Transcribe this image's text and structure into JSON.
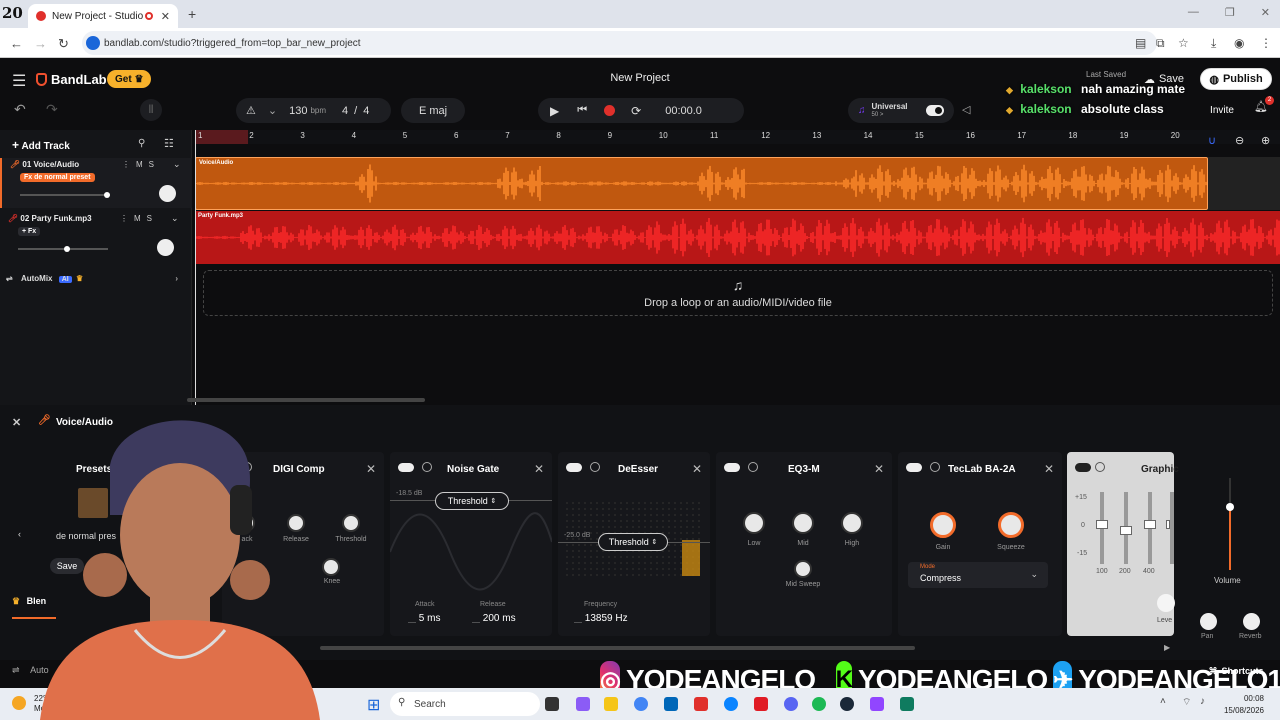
{
  "browser": {
    "counter": "20",
    "tab_title": "New Project - Studio",
    "url": "bandlab.com/studio?triggered_from=top_bar_new_project"
  },
  "app": {
    "brand": "BandLab",
    "get_label": "Get",
    "project_title": "New Project",
    "last_saved": "Last Saved",
    "save_label": "Save",
    "publish_label": "Publish",
    "invite_label": "Invite",
    "notification_count": "2"
  },
  "toolbar": {
    "tempo": "130",
    "tempo_unit": "bpm",
    "time_sig_num": "4",
    "time_sig_sep": "/",
    "time_sig_den": "4",
    "key": "E maj",
    "time": "00:00.0",
    "universal_label": "Universal",
    "universal_sub": "50 >"
  },
  "tracks": [
    {
      "label": "01  Voice/Audio",
      "fx": "Fx de normal preset",
      "clip": "Voice/Audio",
      "color": "#c0580f"
    },
    {
      "label": "02  Party Funk.mp3",
      "fx": "+ Fx",
      "clip": "Party Funk.mp3",
      "color": "#b81717"
    }
  ],
  "track_controls": {
    "mute": "M",
    "solo": "S"
  },
  "sidebar": {
    "add_track": "Add Track",
    "automix": "AutoMix",
    "ai_badge": "AI"
  },
  "ruler": [
    "1",
    "2",
    "3",
    "4",
    "5",
    "6",
    "7",
    "8",
    "9",
    "10",
    "11",
    "12",
    "13",
    "14",
    "15",
    "16",
    "17",
    "18",
    "19",
    "20"
  ],
  "dropzone": "Drop a loop or an audio/MIDI/video file",
  "chat": [
    {
      "user": "kalekson",
      "message": "nah amazing mate"
    },
    {
      "user": "kalekson",
      "message": "absolute class"
    }
  ],
  "fx_panel": {
    "track_name": "Voice/Audio",
    "presets_label": "Presets",
    "preset_name": "de normal pres",
    "save_label": "Save",
    "blend_label": "Blen",
    "auto_label": "Auto",
    "effects": {
      "digi_comp": {
        "title": "DIGI Comp",
        "knobs": [
          "ack",
          "Release",
          "Threshold",
          "Knee"
        ]
      },
      "noise_gate": {
        "title": "Noise Gate",
        "threshold_label": "Threshold",
        "threshold_db": "-18.5 dB",
        "attack_label": "Attack",
        "attack_value": "5 ms",
        "release_label": "Release",
        "release_value": "200 ms"
      },
      "deesser": {
        "title": "DeEsser",
        "threshold_label": "Threshold",
        "threshold_db": "-25.0 dB",
        "freq_label": "Frequency",
        "freq_value": "13859 Hz"
      },
      "eq3m": {
        "title": "EQ3-M",
        "knobs": [
          "Low",
          "Mid",
          "High",
          "Mid Sweep"
        ]
      },
      "teclab": {
        "title": "TecLab BA-2A",
        "knobs": [
          "Gain",
          "Squeeze"
        ],
        "mode_label": "Mode",
        "mode_value": "Compress"
      },
      "graphic": {
        "title": "Graphic",
        "scale": [
          "+15",
          "0",
          "-15"
        ],
        "bands": [
          "100",
          "200",
          "400"
        ],
        "level_label": "Leve"
      }
    },
    "master": {
      "volume": "Volume",
      "pan": "Pan",
      "reverb": "Reverb"
    },
    "shortcuts": "Shortcuts"
  },
  "social": {
    "instagram": "YODEANGELO_",
    "kick": "YODEANGELO",
    "twitter": "YODEANGELO1"
  },
  "taskbar": {
    "search": "Search",
    "weather_temp": "22°C",
    "weather_sub": "Mo",
    "time": "00:08",
    "date": "15/08/2026"
  }
}
